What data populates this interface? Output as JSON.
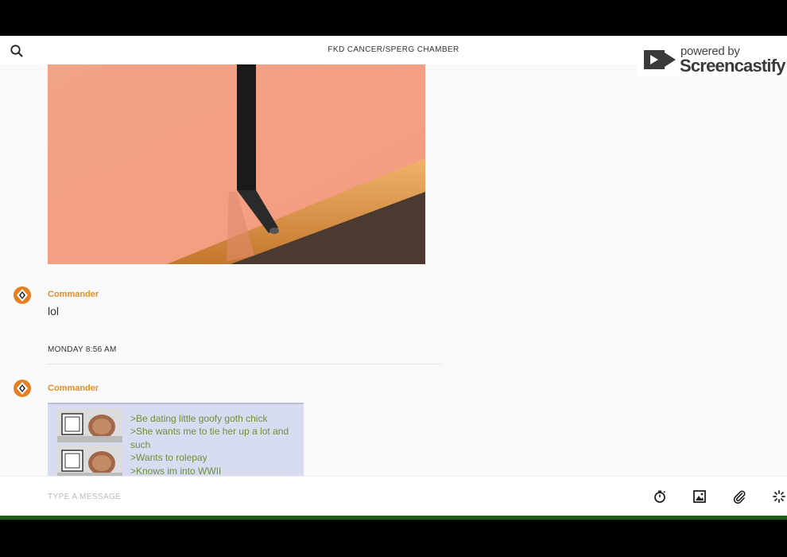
{
  "header": {
    "title": "FKD CANCER/SPERG CHAMBER"
  },
  "watermark": {
    "powered_by": "powered by",
    "brand": "Screencastify"
  },
  "messages": [
    {
      "author": "Commander",
      "text": "lol"
    },
    {
      "author": "Commander",
      "greentext": [
        ">Be dating little goofy goth chick",
        ">She wants me to tie her up a lot and such",
        ">Wants to rolepay",
        ">Knows im into WWII"
      ]
    }
  ],
  "day_separator": "MONDAY 8:56 AM",
  "composer": {
    "placeholder": "TYPE A MESSAGE"
  },
  "colors": {
    "author": "#e58e26",
    "greentext": "#6f8f38",
    "accent_bar": "#1e5a1a"
  },
  "icons": {
    "search": "search-icon",
    "timer": "stopwatch-icon",
    "image": "image-icon",
    "attach": "paperclip-icon",
    "loading": "spinner-icon"
  }
}
